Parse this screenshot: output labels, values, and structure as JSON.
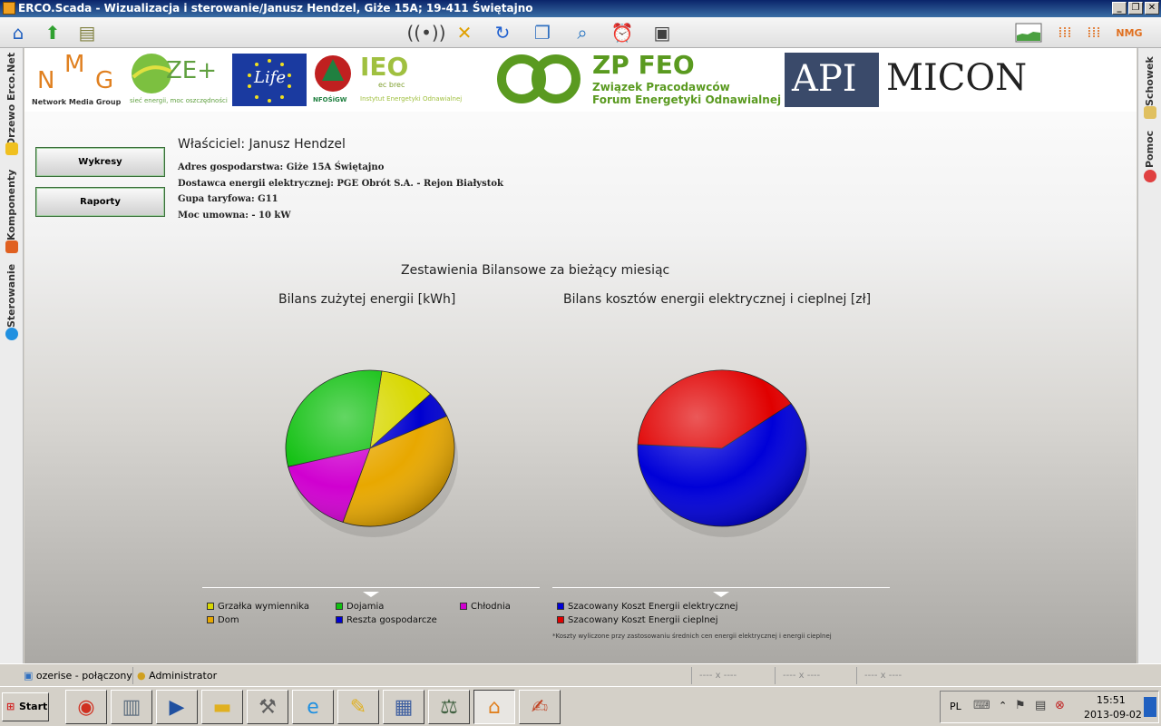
{
  "window": {
    "title": "ERCO.Scada - Wizualizacja i sterowanie/Janusz Hendzel, Giże 15A; 19-411 Świętajno",
    "minimize": "_",
    "restore": "❐",
    "close": "✕"
  },
  "toolbar": {
    "icons": [
      "home-icon",
      "up-arrow-icon",
      "book-icon",
      "signal-icon",
      "tools-icon",
      "refresh-icon",
      "windows-icon",
      "search-icon",
      "alarm-clock-icon",
      "inspect-icon",
      "chart-icon",
      "grid-icon",
      "grid-icon-2",
      "nmg-logo"
    ],
    "nmg_label": "NMG"
  },
  "left_panel": {
    "tabs": [
      {
        "label": "Drzewo Erco.Net",
        "icon": "tree-icon",
        "color": "#f0c020"
      },
      {
        "label": "Komponenty",
        "icon": "components-icon",
        "color": "#e06020"
      },
      {
        "label": "Sterowanie",
        "icon": "control-icon",
        "color": "#2090e0"
      }
    ]
  },
  "right_panel": {
    "tabs": [
      {
        "label": "Schowek",
        "icon": "clipboard-icon"
      },
      {
        "label": "Pomoc",
        "icon": "help-icon"
      }
    ]
  },
  "logos": {
    "nmg_caption": "Network Media Group",
    "oze_text": "ZE+",
    "oze_caption": "sieć energii, moc oszczędności",
    "life_text": "Life",
    "nfos_caption": "NFOŚiGW",
    "ieo_text": "IEO",
    "ieo_sub": "ec brec",
    "ieo_caption": "Instytut Energetyki Odnawialnej",
    "zpfeo_title": "ZP FEO",
    "zpfeo_line1": "Związek Pracodawców",
    "zpfeo_line2": "Forum Energetyki Odnawialnej",
    "api_text": "API",
    "micon_text": "MICON"
  },
  "buttons": {
    "wykresy": "Wykresy",
    "raporty": "Raporty"
  },
  "owner": {
    "name_line": "Właściciel: Janusz Hendzel",
    "address": "Adres gospodarstwa: Giże 15A Świętajno",
    "supplier": "Dostawca energii elektrycznej: PGE Obrót S.A. - Rejon Białystok",
    "tariff": "Gupa taryfowa: G11",
    "power": "Moc umowna: - 10 kW"
  },
  "section_title": "Zestawienia Bilansowe za bieżący miesiąc",
  "chart_data": [
    {
      "type": "pie",
      "title": "Bilans zużytej energii [kWh]",
      "categories": [
        "Grzałka wymiennika",
        "Reszta gospodarcze",
        "Dom",
        "Chłodnia",
        "Dojamia"
      ],
      "values": [
        10.5,
        5.5,
        37,
        16,
        31
      ],
      "colors": [
        "#d8d800",
        "#0000d0",
        "#e8a800",
        "#d000d0",
        "#10c010"
      ],
      "legend": [
        {
          "label": "Grzałka wymiennika",
          "color": "#d8d800"
        },
        {
          "label": "Dojamia",
          "color": "#10c010"
        },
        {
          "label": "Chłodnia",
          "color": "#d000d0"
        },
        {
          "label": "Dom",
          "color": "#e8a800"
        },
        {
          "label": "Reszta gospodarcze",
          "color": "#0000d0"
        }
      ]
    },
    {
      "type": "pie",
      "title": "Bilans kosztów energii elektrycznej i cieplnej [zł]",
      "categories": [
        "Szacowany Koszt Energii elektrycznej",
        "Szacowany Koszt Energii cieplnej"
      ],
      "values": [
        60.5,
        39.5
      ],
      "colors": [
        "#0000d8",
        "#e00000"
      ],
      "legend": [
        {
          "label": "Szacowany Koszt Energii elektrycznej",
          "color": "#0000d8"
        },
        {
          "label": "Szacowany Koszt Energii cieplnej",
          "color": "#e00000"
        }
      ],
      "footnote": "*Koszty wyliczone przy zastosowaniu średnich cen energii elektrycznej i energii cieplnej"
    }
  ],
  "status": {
    "connection": "ozerise - połączony",
    "user": "Administrator",
    "disabled1": "---- x ----",
    "disabled2": "---- x ----",
    "disabled3": "---- x ----"
  },
  "taskbar": {
    "start": "Start",
    "apps": [
      "chrome-icon",
      "server-icon",
      "powershell-icon",
      "folder-icon",
      "tools-icon",
      "ie-icon",
      "notes-icon",
      "scada-icon",
      "scales-icon",
      "factory-icon",
      "edit-icon"
    ],
    "lang": "PL",
    "time": "15:51",
    "date": "2013-09-02"
  }
}
